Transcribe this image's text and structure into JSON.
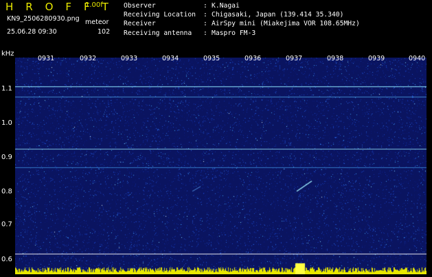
{
  "header": {
    "logo": "H R O F F T",
    "version": "1.00f",
    "filename": "KN9_2506280930.png",
    "meteor_label": "meteor",
    "datetime": "25.06.28 09:30",
    "meteor_count": "102"
  },
  "info": [
    {
      "label": "Observer",
      "sep": ":",
      "value": "K.Nagai"
    },
    {
      "label": "Receiving Location",
      "sep": ":",
      "value": "Chigasaki, Japan (139.414 35.340)"
    },
    {
      "label": "Receiver",
      "sep": ":",
      "value": "AirSpy mini (Miakejima VOR 108.65MHz)"
    },
    {
      "label": "Receiving antenna",
      "sep": ":",
      "value": "Maspro FM-3"
    }
  ],
  "axis": {
    "y_unit": "kHz",
    "y_ticks": [
      "1.1",
      "1.0",
      "0.9",
      "0.8",
      "0.7",
      "0.6"
    ],
    "time_ticks": [
      "0931",
      "0932",
      "0933",
      "0934",
      "0935",
      "0936",
      "0937",
      "0938",
      "0939",
      "0940"
    ]
  },
  "colors": {
    "background": "#000000",
    "plot_bg": "#0a1460",
    "accent_yellow": "#e8e800",
    "carrier": "#9ff0ff"
  }
}
